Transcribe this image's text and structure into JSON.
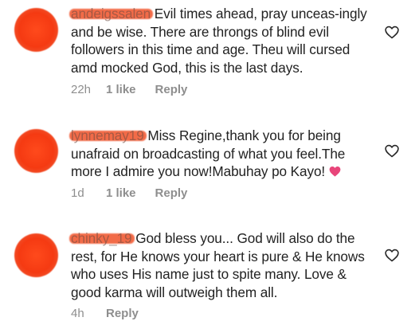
{
  "comments": [
    {
      "username": "andeigssalen",
      "text": "Evil times ahead, pray unceas-ingly and be wise. There are throngs of blind evil followers in this time and age. Theu will cursed amd mocked God, this is the last days.",
      "time": "22h",
      "likes": "1 like",
      "reply_label": "Reply"
    },
    {
      "username": "lynnemay19",
      "text": "Miss Regine,thank you for being unafraid on broadcasting of what you feel.The more I admire you now!Mabuhay po Kayo!",
      "emoji": "pink-heart-emoji",
      "time": "1d",
      "likes": "1 like",
      "reply_label": "Reply"
    },
    {
      "username": "chinky_19",
      "text": "God bless you... God will also do the rest, for He knows your heart is pure & He knows who uses His name just to spite many. Love & good karma will outweigh them all.",
      "time": "4h",
      "likes": "",
      "reply_label": "Reply"
    }
  ],
  "colors": {
    "text": "#222222",
    "meta": "#8e8e8e",
    "avatar_redaction": "#f53a12",
    "emoji_heart": "#e8457a"
  },
  "icons": {
    "like_button": "heart-outline-icon"
  }
}
